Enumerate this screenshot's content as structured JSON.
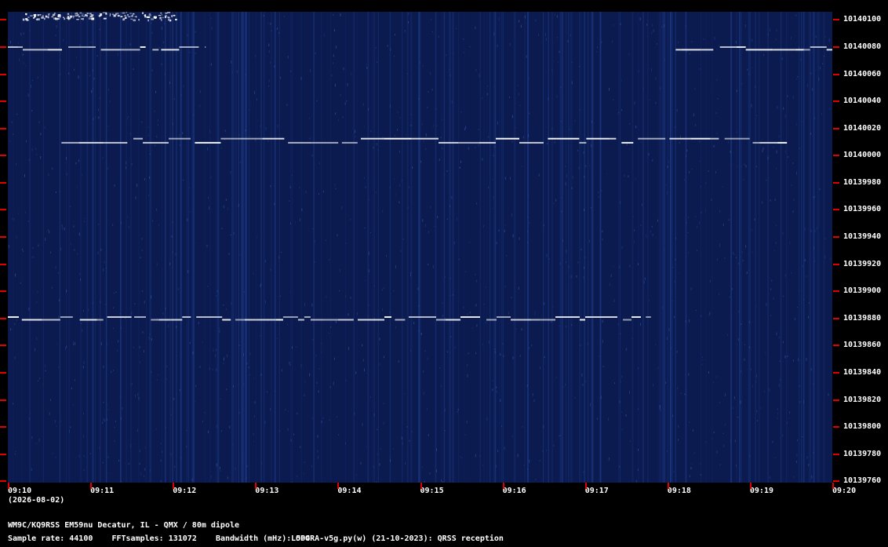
{
  "chart_data": {
    "type": "heatmap",
    "title": "",
    "xlabel": "",
    "ylabel": "",
    "x_ticks": [
      "09:10",
      "09:11",
      "09:12",
      "09:13",
      "09:14",
      "09:15",
      "09:16",
      "09:17",
      "09:18",
      "09:19",
      "09:20"
    ],
    "y_ticks": [
      10140100,
      10140080,
      10140060,
      10140040,
      10140020,
      10140000,
      10139980,
      10139960,
      10139940,
      10139920,
      10139900,
      10139880,
      10139860,
      10139840,
      10139820,
      10139800,
      10139780,
      10139760
    ],
    "xlim_minutes": [
      0,
      10
    ],
    "ylim_hz": [
      10139759,
      10140106
    ],
    "background_color": "#0b1a4f",
    "signal_color": "#ffffff",
    "traces": [
      {
        "center_hz": 10140011,
        "shift_hz": 3,
        "start_min": 0.65,
        "end_min": 9.45
      },
      {
        "center_hz": 10139880,
        "shift_hz": 2,
        "start_min": 0.0,
        "end_min": 7.8
      },
      {
        "center_hz": 10140079,
        "shift_hz": 2,
        "start_min": 0.0,
        "end_min": 2.4
      },
      {
        "center_hz": 10140079,
        "shift_hz": 2,
        "start_min": 8.1,
        "end_min": 10.0
      }
    ]
  },
  "date": "(2026-08-02)",
  "station": "WM9C/KQ9RSS EM59nu Decatur, IL - QMX / 80m dipole",
  "info": {
    "sample_rate": "Sample rate: 44100",
    "fft_samples": "FFTsamples: 131072",
    "bandwidth": "Bandwidth (mHz): 504"
  },
  "software": "LOPORA-v5g.py(w) (21-10-2023): QRSS reception",
  "tick_color": "#e00000"
}
